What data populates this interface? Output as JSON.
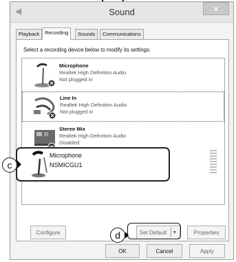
{
  "window": {
    "title": "Sound",
    "close_glyph": "×"
  },
  "tabs": [
    {
      "label": "Playback",
      "active": false
    },
    {
      "label": "Recording",
      "active": true
    },
    {
      "label": "Sounds",
      "active": false
    },
    {
      "label": "Communications",
      "active": false
    }
  ],
  "instruction": "Select a recording device below to modify its settings:",
  "devices": [
    {
      "name": "Microphone",
      "driver": "Realtek High Definition Audio",
      "status": "Not plugged in",
      "icon": "microphone-icon"
    },
    {
      "name": "Line In",
      "driver": "Realtek High Definition Audio",
      "status": "Not plugged in",
      "icon": "line-in-cable-icon"
    },
    {
      "name": "Stereo Mix",
      "driver": "Realtek High Definition Audio",
      "status": "Disabled",
      "icon": "sound-card-icon"
    }
  ],
  "highlighted_device": {
    "name": "Microphone",
    "sub": "NSMICGU1",
    "icon": "microphone-icon"
  },
  "callouts": {
    "c": "c",
    "d": "d"
  },
  "buttons": {
    "configure": "Configure",
    "set_default": "Set Default",
    "properties": "Properties",
    "ok": "OK",
    "cancel": "Cancel",
    "apply": "Apply"
  }
}
